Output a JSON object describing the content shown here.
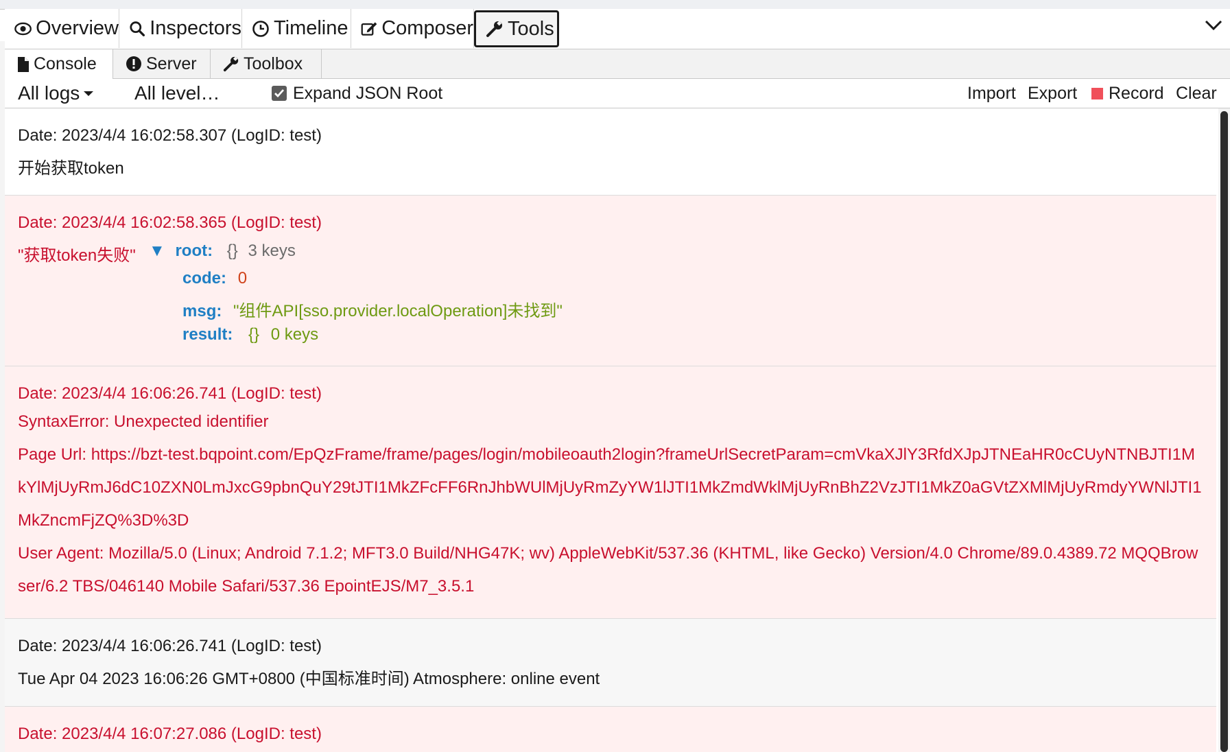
{
  "tabs": [
    {
      "label": "Overview",
      "icon": "eye-icon"
    },
    {
      "label": "Inspectors",
      "icon": "search-icon"
    },
    {
      "label": "Timeline",
      "icon": "clock-icon"
    },
    {
      "label": "Composer",
      "icon": "edit-icon"
    },
    {
      "label": "Tools",
      "icon": "wrench-icon",
      "active": true
    }
  ],
  "subtabs": [
    {
      "label": "Console",
      "icon": "file-icon",
      "active": true
    },
    {
      "label": "Server",
      "icon": "alert-icon"
    },
    {
      "label": "Toolbox",
      "icon": "wrench-icon"
    }
  ],
  "toolbar": {
    "logs_filter": "All logs",
    "level_filter": "All level…",
    "expand_json_label": "Expand JSON Root",
    "expand_json_checked": true,
    "import": "Import",
    "export": "Export",
    "record": "Record",
    "clear": "Clear"
  },
  "logs": [
    {
      "type": "info",
      "date": "Date: 2023/4/4 16:02:58.307 (LogID: test)",
      "message": "开始获取token"
    },
    {
      "type": "error",
      "date": "Date: 2023/4/4 16:02:58.365 (LogID: test)",
      "message": "\"获取token失败\"",
      "tree": {
        "toggle": "▼",
        "root_key": "root:",
        "root_braces": "{}",
        "root_count": "3 keys",
        "code_key": "code:",
        "code_val": "0",
        "msg_key": "msg:",
        "msg_val": "\"组件API[sso.provider.localOperation]未找到\"",
        "result_key": "result:",
        "result_braces": "{}",
        "result_count": "0 keys"
      }
    },
    {
      "type": "error",
      "date": "Date: 2023/4/4 16:06:26.741 (LogID: test)",
      "lines": [
        "SyntaxError: Unexpected identifier",
        "Page Url: https://bzt-test.bqpoint.com/EpQzFrame/frame/pages/login/mobileoauth2login?frameUrlSecretParam=cmVkaXJlY3RfdXJpJTNEaHR0cCUyNTNBJTI1M",
        "kYlMjUyRmJ6dC10ZXN0LmJxcG9pbnQuY29tJTI1MkZFcFF6RnJhbWUlMjUyRmZyYW1lJTI1MkZmdWklMjUyRnBhZ2VzJTI1MkZ0aGVtZXMlMjUyRmdyYWNlJTI1",
        "MkZncmFjZQ%3D%3D",
        "User Agent: Mozilla/5.0 (Linux; Android 7.1.2; MFT3.0 Build/NHG47K; wv) AppleWebKit/537.36 (KHTML, like Gecko) Version/4.0 Chrome/89.0.4389.72 MQQBrow",
        "ser/6.2 TBS/046140 Mobile Safari/537.36 EpointEJS/M7_3.5.1"
      ]
    },
    {
      "type": "gray",
      "date": "Date: 2023/4/4 16:06:26.741 (LogID: test)",
      "message": "Tue Apr 04 2023 16:06:26 GMT+0800 (中国标准时间) Atmosphere: online event"
    },
    {
      "type": "error",
      "date": "Date: 2023/4/4 16:07:27.086 (LogID: test)"
    }
  ]
}
